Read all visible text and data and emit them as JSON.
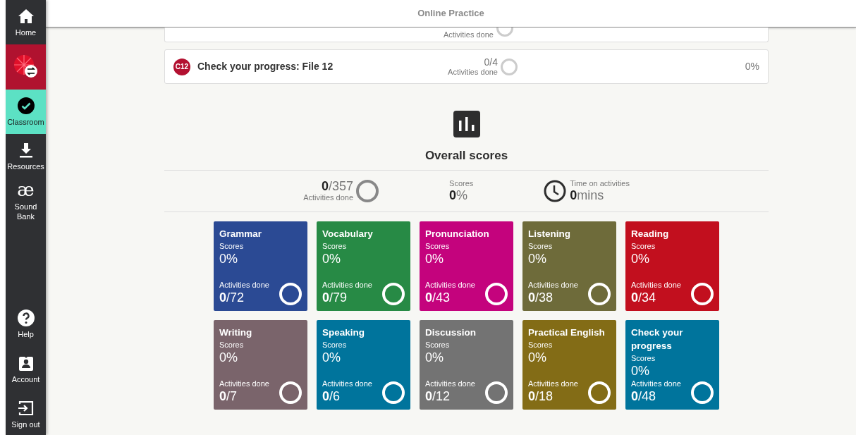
{
  "header": {
    "title": "Online Practice"
  },
  "sidebar": {
    "top_items": [
      {
        "kind": "home",
        "label": "Home",
        "selected": false
      },
      {
        "kind": "product",
        "selected": false
      },
      {
        "kind": "classroom",
        "label": "Classroom",
        "selected": true
      },
      {
        "kind": "resources",
        "label": "Resources",
        "selected": false
      },
      {
        "kind": "soundbank",
        "glyph": "æ",
        "label": "Sound Bank",
        "selected": false
      }
    ],
    "bottom_items": [
      {
        "kind": "help",
        "label": "Help"
      },
      {
        "kind": "account",
        "label": "Account"
      },
      {
        "kind": "signout",
        "label": "Sign out"
      }
    ]
  },
  "lessons": [
    {
      "activities_label": "Activities done"
    },
    {
      "badge": "C12",
      "title": "Check your progress: File 12",
      "done": "0/4",
      "activities_label": "Activities done",
      "score": "0%"
    }
  ],
  "overall": {
    "title": "Overall scores",
    "activities_done": "0",
    "activities_total": "/357",
    "activities_label": "Activities done",
    "scores_label": "Scores",
    "score_value": "0",
    "score_unit": "%",
    "time_label": "Time on activities",
    "time_value": "0",
    "time_unit": "mins"
  },
  "tiles": [
    {
      "name": "Grammar",
      "scores_label": "Scores",
      "score": "0%",
      "activities_label": "Activities done",
      "done": "0",
      "total": "/72",
      "color": "#2b4a94"
    },
    {
      "name": "Vocabulary",
      "scores_label": "Scores",
      "score": "0%",
      "activities_label": "Activities done",
      "done": "0",
      "total": "/79",
      "color": "#278a45"
    },
    {
      "name": "Pronunciation",
      "scores_label": "Scores",
      "score": "0%",
      "activities_label": "Activities done",
      "done": "0",
      "total": "/43",
      "color": "#c4037d"
    },
    {
      "name": "Listening",
      "scores_label": "Scores",
      "score": "0%",
      "activities_label": "Activities done",
      "done": "0",
      "total": "/38",
      "color": "#6e6b3a"
    },
    {
      "name": "Reading",
      "scores_label": "Scores",
      "score": "0%",
      "activities_label": "Activities done",
      "done": "0",
      "total": "/34",
      "color": "#c20f1e"
    },
    {
      "name": "Writing",
      "scores_label": "Scores",
      "score": "0%",
      "activities_label": "Activities done",
      "done": "0",
      "total": "/7",
      "color": "#7a646b"
    },
    {
      "name": "Speaking",
      "scores_label": "Scores",
      "score": "0%",
      "activities_label": "Activities done",
      "done": "0",
      "total": "/6",
      "color": "#00749c"
    },
    {
      "name": "Discussion",
      "scores_label": "Scores",
      "score": "0%",
      "activities_label": "Activities done",
      "done": "0",
      "total": "/12",
      "color": "#737373"
    },
    {
      "name": "Practical English",
      "scores_label": "Scores",
      "score": "0%",
      "activities_label": "Activities done",
      "done": "0",
      "total": "/18",
      "color": "#836c16"
    },
    {
      "name": "Check your progress",
      "scores_label": "Scores",
      "score": "0%",
      "activities_label": "Activities done",
      "done": "0",
      "total": "/48",
      "color": "#00749c"
    }
  ]
}
